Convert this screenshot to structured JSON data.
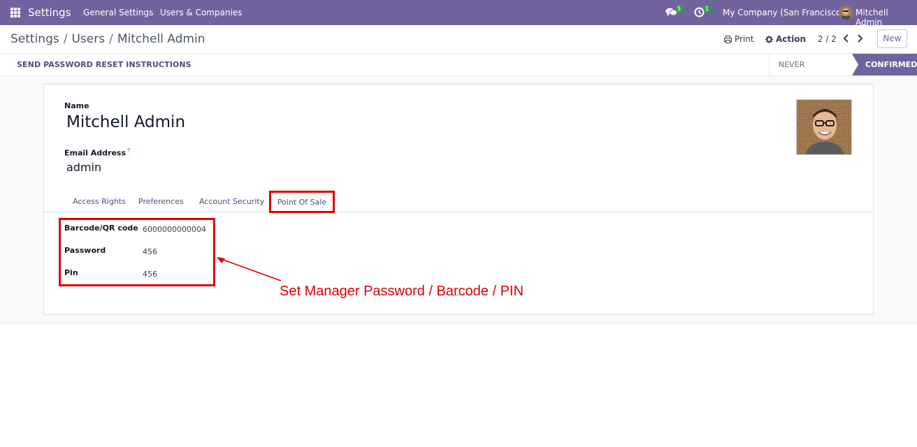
{
  "navbar": {
    "app_title": "Settings",
    "menu": [
      "General Settings",
      "Users & Companies"
    ],
    "messages_count": "5",
    "activities_count": "1",
    "company": "My Company (San Francisco)",
    "user": "Mitchell Admin"
  },
  "control": {
    "breadcrumb": [
      "Settings",
      "Users",
      "Mitchell Admin"
    ],
    "print_label": "Print",
    "action_label": "Action",
    "pager": "2 / 2",
    "new_label": "New"
  },
  "statusbar": {
    "reset_button": "SEND PASSWORD RESET INSTRUCTIONS",
    "stages": [
      "NEVER CONNECTED",
      "CONFIRMED"
    ],
    "active_stage": "CONFIRMED"
  },
  "form": {
    "name_label": "Name",
    "name_value": "Mitchell Admin",
    "email_label": "Email Address",
    "email_help": "?",
    "email_value": "admin",
    "tabs": [
      "Access Rights",
      "Preferences",
      "Account Security",
      "Point Of Sale"
    ],
    "active_tab": "Point Of Sale",
    "pos_fields": [
      {
        "label": "Barcode/QR code",
        "value": "6000000000004"
      },
      {
        "label": "Password",
        "value": "456"
      },
      {
        "label": "Pin",
        "value": "456"
      }
    ]
  },
  "annotation": {
    "text": "Set Manager Password / Barcode / PIN",
    "color": "#e00000"
  },
  "colors": {
    "brand": "#71639e",
    "highlight": "#e00000"
  }
}
